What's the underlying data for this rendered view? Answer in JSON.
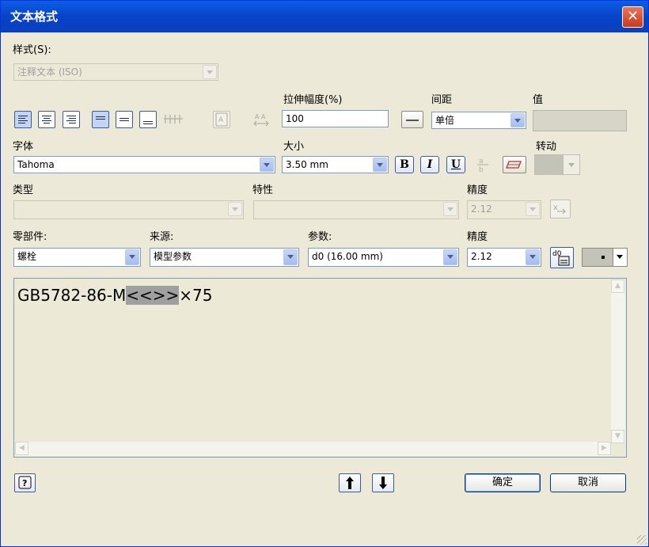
{
  "window": {
    "title": "文本格式",
    "close": "✕"
  },
  "style": {
    "label": "样式(S):",
    "value": "注释文本 (ISO)"
  },
  "stretch": {
    "label": "拉伸幅度(%)",
    "value": "100"
  },
  "spacing": {
    "label": "间距",
    "value": "单倍"
  },
  "value_label": "值",
  "font": {
    "label": "字体",
    "value": "Tahoma"
  },
  "size": {
    "label": "大小",
    "value": "3.50 mm"
  },
  "format_buttons": {
    "bold": "B",
    "italic": "I",
    "underline": "U"
  },
  "rotate": {
    "label": "转动"
  },
  "type": {
    "label": "类型"
  },
  "property": {
    "label": "特性"
  },
  "precision1": {
    "label": "精度",
    "value": "2.12"
  },
  "component": {
    "label": "零部件:",
    "value": "螺栓"
  },
  "source": {
    "label": "来源:",
    "value": "模型参数"
  },
  "parameter": {
    "label": "参数:",
    "value": "d0 (16.00 mm)"
  },
  "precision2": {
    "label": "精度",
    "value": "2.12"
  },
  "editor": {
    "prefix": "GB5782-86-M",
    "highlight": "<<>>",
    "suffix": "×75"
  },
  "buttons": {
    "ok": "确定",
    "cancel": "取消"
  },
  "icons": [
    "align-left-icon",
    "align-center-icon",
    "align-right-icon",
    "valign-top-icon",
    "valign-middle-icon",
    "valign-bottom-icon",
    "text-stretch-icon",
    "insert-parameter-icon",
    "help-icon",
    "move-up-icon",
    "move-down-icon"
  ]
}
